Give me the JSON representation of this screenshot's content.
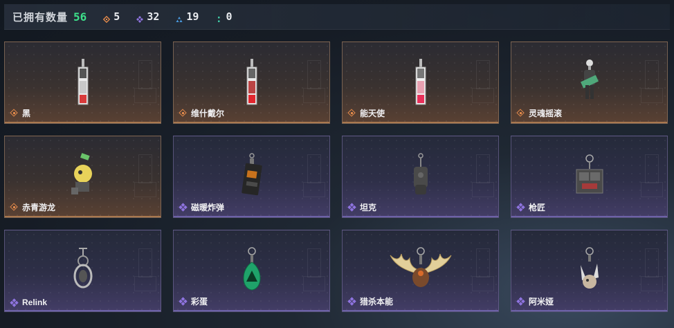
{
  "header": {
    "owned_label": "已拥有数量",
    "owned_count": "56",
    "stats": [
      {
        "icon": "orange-diamond-icon",
        "value": "5",
        "color": "#e1894b"
      },
      {
        "icon": "purple-diamond-icon",
        "value": "32",
        "color": "#8f74e0"
      },
      {
        "icon": "blue-triangle-icon",
        "value": "19",
        "color": "#4a9be0"
      },
      {
        "icon": "green-dots-icon",
        "value": "0",
        "color": "#3fc7a4"
      }
    ]
  },
  "cards": [
    {
      "name": "黑",
      "rarity": "orange",
      "item": "tag-charm"
    },
    {
      "name": "维什戴尔",
      "rarity": "orange",
      "item": "tag-charm"
    },
    {
      "name": "能天使",
      "rarity": "orange",
      "item": "tag-charm"
    },
    {
      "name": "灵魂摇滚",
      "rarity": "orange",
      "item": "guitar-figure-charm"
    },
    {
      "name": "赤青游龙",
      "rarity": "orange",
      "item": "dragon-figure-charm"
    },
    {
      "name": "磁暖炸弹",
      "rarity": "purple",
      "item": "bomb-charm"
    },
    {
      "name": "坦克",
      "rarity": "purple",
      "item": "tank-charm"
    },
    {
      "name": "枪匠",
      "rarity": "purple",
      "item": "box-charm"
    },
    {
      "name": "Relink",
      "rarity": "purple",
      "item": "mech-charm"
    },
    {
      "name": "彩蛋",
      "rarity": "purple",
      "item": "green-egg-charm"
    },
    {
      "name": "猎杀本能",
      "rarity": "purple",
      "item": "antler-charm"
    },
    {
      "name": "阿米娅",
      "rarity": "purple",
      "item": "bunny-charm"
    }
  ]
}
